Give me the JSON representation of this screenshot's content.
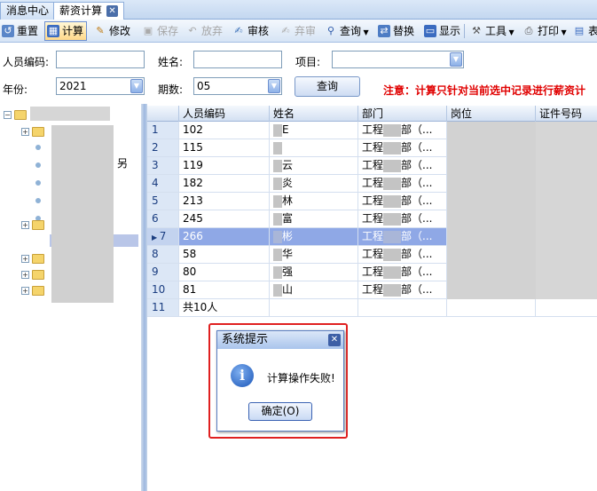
{
  "tabs": [
    {
      "label": "消息中心",
      "active": false
    },
    {
      "label": "薪资计算",
      "active": true
    }
  ],
  "toolbar": {
    "buttons": [
      {
        "label": "重置",
        "icon": "reset-icon",
        "enabled": true
      },
      {
        "label": "计算",
        "icon": "calculator-icon",
        "enabled": true,
        "active": true
      },
      {
        "label": "修改",
        "icon": "edit-icon",
        "enabled": true
      },
      {
        "label": "保存",
        "icon": "save-icon",
        "enabled": false
      },
      {
        "label": "放弃",
        "icon": "undo-icon",
        "enabled": false
      },
      {
        "label": "审核",
        "icon": "approve-icon",
        "enabled": true
      },
      {
        "label": "弃审",
        "icon": "unapprove-icon",
        "enabled": false
      },
      {
        "label": "查询",
        "icon": "search-icon",
        "enabled": true,
        "dropdown": true
      },
      {
        "label": "替换",
        "icon": "replace-icon",
        "enabled": true
      },
      {
        "label": "显示",
        "icon": "display-icon",
        "enabled": true
      },
      {
        "label": "工具",
        "icon": "tools-icon",
        "enabled": true,
        "dropdown": true
      },
      {
        "label": "打印",
        "icon": "print-icon",
        "enabled": true,
        "dropdown": true
      },
      {
        "label": "表",
        "icon": "table-icon",
        "enabled": true
      }
    ]
  },
  "filter": {
    "emp_code_label": "人员编码:",
    "emp_code_value": "",
    "name_label": "姓名:",
    "name_value": "",
    "item_label": "项目:",
    "item_value": "",
    "year_label": "年份:",
    "year_value": "2021",
    "period_label": "期数:",
    "period_value": "05",
    "query_button": "查询",
    "notice": "注意：计算只针对当前选中记录进行薪资计"
  },
  "grid": {
    "columns": [
      "人员编码",
      "姓名",
      "部门",
      "岗位",
      "证件号码"
    ],
    "rows": [
      {
        "no": "1",
        "code": "102",
        "name": "",
        "name_tail": "E",
        "dept": "工程",
        "dept_tail": "部（..."
      },
      {
        "no": "2",
        "code": "115",
        "name": "",
        "name_tail": "",
        "dept": "工程",
        "dept_tail": "部（..."
      },
      {
        "no": "3",
        "code": "119",
        "name": "",
        "name_tail": "云",
        "dept": "工程",
        "dept_tail": "部（..."
      },
      {
        "no": "4",
        "code": "182",
        "name": "",
        "name_tail": "炎",
        "dept": "工程",
        "dept_tail": "部（..."
      },
      {
        "no": "5",
        "code": "213",
        "name": "",
        "name_tail": "林",
        "dept": "工程",
        "dept_tail": "部（..."
      },
      {
        "no": "6",
        "code": "245",
        "name": "",
        "name_tail": "富",
        "dept": "工程",
        "dept_tail": "部（..."
      },
      {
        "no": "7",
        "code": "266",
        "name": "",
        "name_tail": "彬",
        "dept": "工程",
        "dept_tail": "部（...",
        "selected": true
      },
      {
        "no": "8",
        "code": "58",
        "name": "",
        "name_tail": "华",
        "dept": "工程",
        "dept_tail": "部（..."
      },
      {
        "no": "9",
        "code": "80",
        "name": "",
        "name_tail": "强",
        "dept": "工程",
        "dept_tail": "部（..."
      },
      {
        "no": "10",
        "code": "81",
        "name": "",
        "name_tail": "山",
        "dept": "工程",
        "dept_tail": "部（..."
      }
    ],
    "footer_no": "11",
    "footer_text": "共10人"
  },
  "tree": {
    "partial_label": "另"
  },
  "dialog": {
    "title": "系统提示",
    "icon": "info-icon",
    "message": "计算操作失败!",
    "ok_button": "确定(O)"
  },
  "colors": {
    "selection": "#8fa8e6",
    "notice": "#e00000",
    "highlight_border": "#e02020"
  }
}
